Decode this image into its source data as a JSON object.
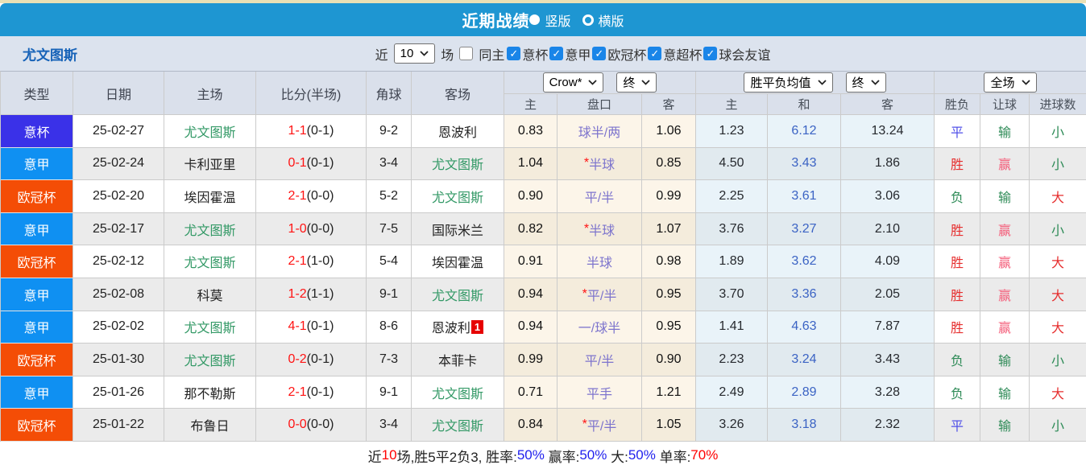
{
  "title_bar": {
    "title": "近期战绩",
    "vertical_label": "竖版",
    "horizontal_label": "横版"
  },
  "filter_bar": {
    "team": "尤文图斯",
    "near_label": "近",
    "count_value": "10",
    "games_label": "场",
    "same_home_label": "同主",
    "competitions": [
      "意杯",
      "意甲",
      "欧冠杯",
      "意超杯",
      "球会友谊"
    ]
  },
  "table": {
    "main_headers": [
      "类型",
      "日期",
      "主场",
      "比分(半场)",
      "角球",
      "客场"
    ],
    "sub_headers": [
      "主",
      "盘口",
      "客",
      "主",
      "和",
      "客",
      "胜负",
      "让球",
      "进球数"
    ],
    "group1": {
      "provider": "Crow*",
      "time": "终"
    },
    "group2": {
      "provider": "胜平负均值",
      "time": "终"
    },
    "group3": {
      "scope": "全场"
    },
    "rows": [
      {
        "type": "意杯",
        "date": "25-02-27",
        "home": "尤文图斯",
        "home_green": true,
        "score_ft": "1-1",
        "score_ht": "0-1",
        "corners": "9-2",
        "away": "恩波利",
        "away_green": false,
        "away_sup": "",
        "odds_home": "0.83",
        "handicap": "球半/两",
        "handicap_star": false,
        "odds_away": "1.06",
        "avg_home": "1.23",
        "avg_draw": "6.12",
        "avg_away": "13.24",
        "result": "平",
        "handicap_result": "输",
        "goals": "小"
      },
      {
        "type": "意甲",
        "date": "25-02-24",
        "home": "卡利亚里",
        "home_green": false,
        "score_ft": "0-1",
        "score_ht": "0-1",
        "corners": "3-4",
        "away": "尤文图斯",
        "away_green": true,
        "away_sup": "",
        "odds_home": "1.04",
        "handicap": "半球",
        "handicap_star": true,
        "odds_away": "0.85",
        "avg_home": "4.50",
        "avg_draw": "3.43",
        "avg_away": "1.86",
        "result": "胜",
        "handicap_result": "赢",
        "goals": "小"
      },
      {
        "type": "欧冠杯",
        "date": "25-02-20",
        "home": "埃因霍温",
        "home_green": false,
        "score_ft": "2-1",
        "score_ht": "0-0",
        "corners": "5-2",
        "away": "尤文图斯",
        "away_green": true,
        "away_sup": "",
        "odds_home": "0.90",
        "handicap": "平/半",
        "handicap_star": false,
        "odds_away": "0.99",
        "avg_home": "2.25",
        "avg_draw": "3.61",
        "avg_away": "3.06",
        "result": "负",
        "handicap_result": "输",
        "goals": "大"
      },
      {
        "type": "意甲",
        "date": "25-02-17",
        "home": "尤文图斯",
        "home_green": true,
        "score_ft": "1-0",
        "score_ht": "0-0",
        "corners": "7-5",
        "away": "国际米兰",
        "away_green": false,
        "away_sup": "",
        "odds_home": "0.82",
        "handicap": "半球",
        "handicap_star": true,
        "odds_away": "1.07",
        "avg_home": "3.76",
        "avg_draw": "3.27",
        "avg_away": "2.10",
        "result": "胜",
        "handicap_result": "赢",
        "goals": "小"
      },
      {
        "type": "欧冠杯",
        "date": "25-02-12",
        "home": "尤文图斯",
        "home_green": true,
        "score_ft": "2-1",
        "score_ht": "1-0",
        "corners": "5-4",
        "away": "埃因霍温",
        "away_green": false,
        "away_sup": "",
        "odds_home": "0.91",
        "handicap": "半球",
        "handicap_star": false,
        "odds_away": "0.98",
        "avg_home": "1.89",
        "avg_draw": "3.62",
        "avg_away": "4.09",
        "result": "胜",
        "handicap_result": "赢",
        "goals": "大"
      },
      {
        "type": "意甲",
        "date": "25-02-08",
        "home": "科莫",
        "home_green": false,
        "score_ft": "1-2",
        "score_ht": "1-1",
        "corners": "9-1",
        "away": "尤文图斯",
        "away_green": true,
        "away_sup": "",
        "odds_home": "0.94",
        "handicap": "平/半",
        "handicap_star": true,
        "odds_away": "0.95",
        "avg_home": "3.70",
        "avg_draw": "3.36",
        "avg_away": "2.05",
        "result": "胜",
        "handicap_result": "赢",
        "goals": "大"
      },
      {
        "type": "意甲",
        "date": "25-02-02",
        "home": "尤文图斯",
        "home_green": true,
        "score_ft": "4-1",
        "score_ht": "0-1",
        "corners": "8-6",
        "away": "恩波利",
        "away_green": false,
        "away_sup": "1",
        "odds_home": "0.94",
        "handicap": "一/球半",
        "handicap_star": false,
        "odds_away": "0.95",
        "avg_home": "1.41",
        "avg_draw": "4.63",
        "avg_away": "7.87",
        "result": "胜",
        "handicap_result": "赢",
        "goals": "大"
      },
      {
        "type": "欧冠杯",
        "date": "25-01-30",
        "home": "尤文图斯",
        "home_green": true,
        "score_ft": "0-2",
        "score_ht": "0-1",
        "corners": "7-3",
        "away": "本菲卡",
        "away_green": false,
        "away_sup": "",
        "odds_home": "0.99",
        "handicap": "平/半",
        "handicap_star": false,
        "odds_away": "0.90",
        "avg_home": "2.23",
        "avg_draw": "3.24",
        "avg_away": "3.43",
        "result": "负",
        "handicap_result": "输",
        "goals": "小"
      },
      {
        "type": "意甲",
        "date": "25-01-26",
        "home": "那不勒斯",
        "home_green": false,
        "score_ft": "2-1",
        "score_ht": "0-1",
        "corners": "9-1",
        "away": "尤文图斯",
        "away_green": true,
        "away_sup": "",
        "odds_home": "0.71",
        "handicap": "平手",
        "handicap_star": false,
        "odds_away": "1.21",
        "avg_home": "2.49",
        "avg_draw": "2.89",
        "avg_away": "3.28",
        "result": "负",
        "handicap_result": "输",
        "goals": "大"
      },
      {
        "type": "欧冠杯",
        "date": "25-01-22",
        "home": "布鲁日",
        "home_green": false,
        "score_ft": "0-0",
        "score_ht": "0-0",
        "corners": "3-4",
        "away": "尤文图斯",
        "away_green": true,
        "away_sup": "",
        "odds_home": "0.84",
        "handicap": "平/半",
        "handicap_star": true,
        "odds_away": "1.05",
        "avg_home": "3.26",
        "avg_draw": "3.18",
        "avg_away": "2.32",
        "result": "平",
        "handicap_result": "输",
        "goals": "小"
      }
    ]
  },
  "footer": {
    "segments": [
      {
        "text": "近",
        "color": "#222222"
      },
      {
        "text": "10",
        "color": "#ff0000"
      },
      {
        "text": "场,胜5平2负3, 胜率:",
        "color": "#222222"
      },
      {
        "text": "50%",
        "color": "#2222ee"
      },
      {
        "text": " 赢率:",
        "color": "#222222"
      },
      {
        "text": "50%",
        "color": "#2222ee"
      },
      {
        "text": " 大:",
        "color": "#222222"
      },
      {
        "text": "50%",
        "color": "#2222ee"
      },
      {
        "text": " 单率:",
        "color": "#222222"
      },
      {
        "text": "70%",
        "color": "#ff0000"
      }
    ]
  },
  "colors": {
    "header_blue": "#1e96d2",
    "top_strip": "#e9e0b5",
    "filter_bar_bg": "#dce3ee",
    "table_header_bg": "#dae0eb",
    "type_badges": {
      "意杯": "#3a31e8",
      "意甲": "#0f90f2",
      "欧冠杯": "#f44d06"
    },
    "team_green": "#339966",
    "score_red": "#ff1313",
    "handicap_purple": "#7d74cd",
    "avg_dark": "#26292e",
    "avg_draw_blue": "#3b63c4",
    "win_red": "#e62e2e",
    "draw_blue": "#5050e8",
    "lose_green": "#2e8b57",
    "win_pink": "#f4607c",
    "away_sup_red": "#e60000"
  }
}
